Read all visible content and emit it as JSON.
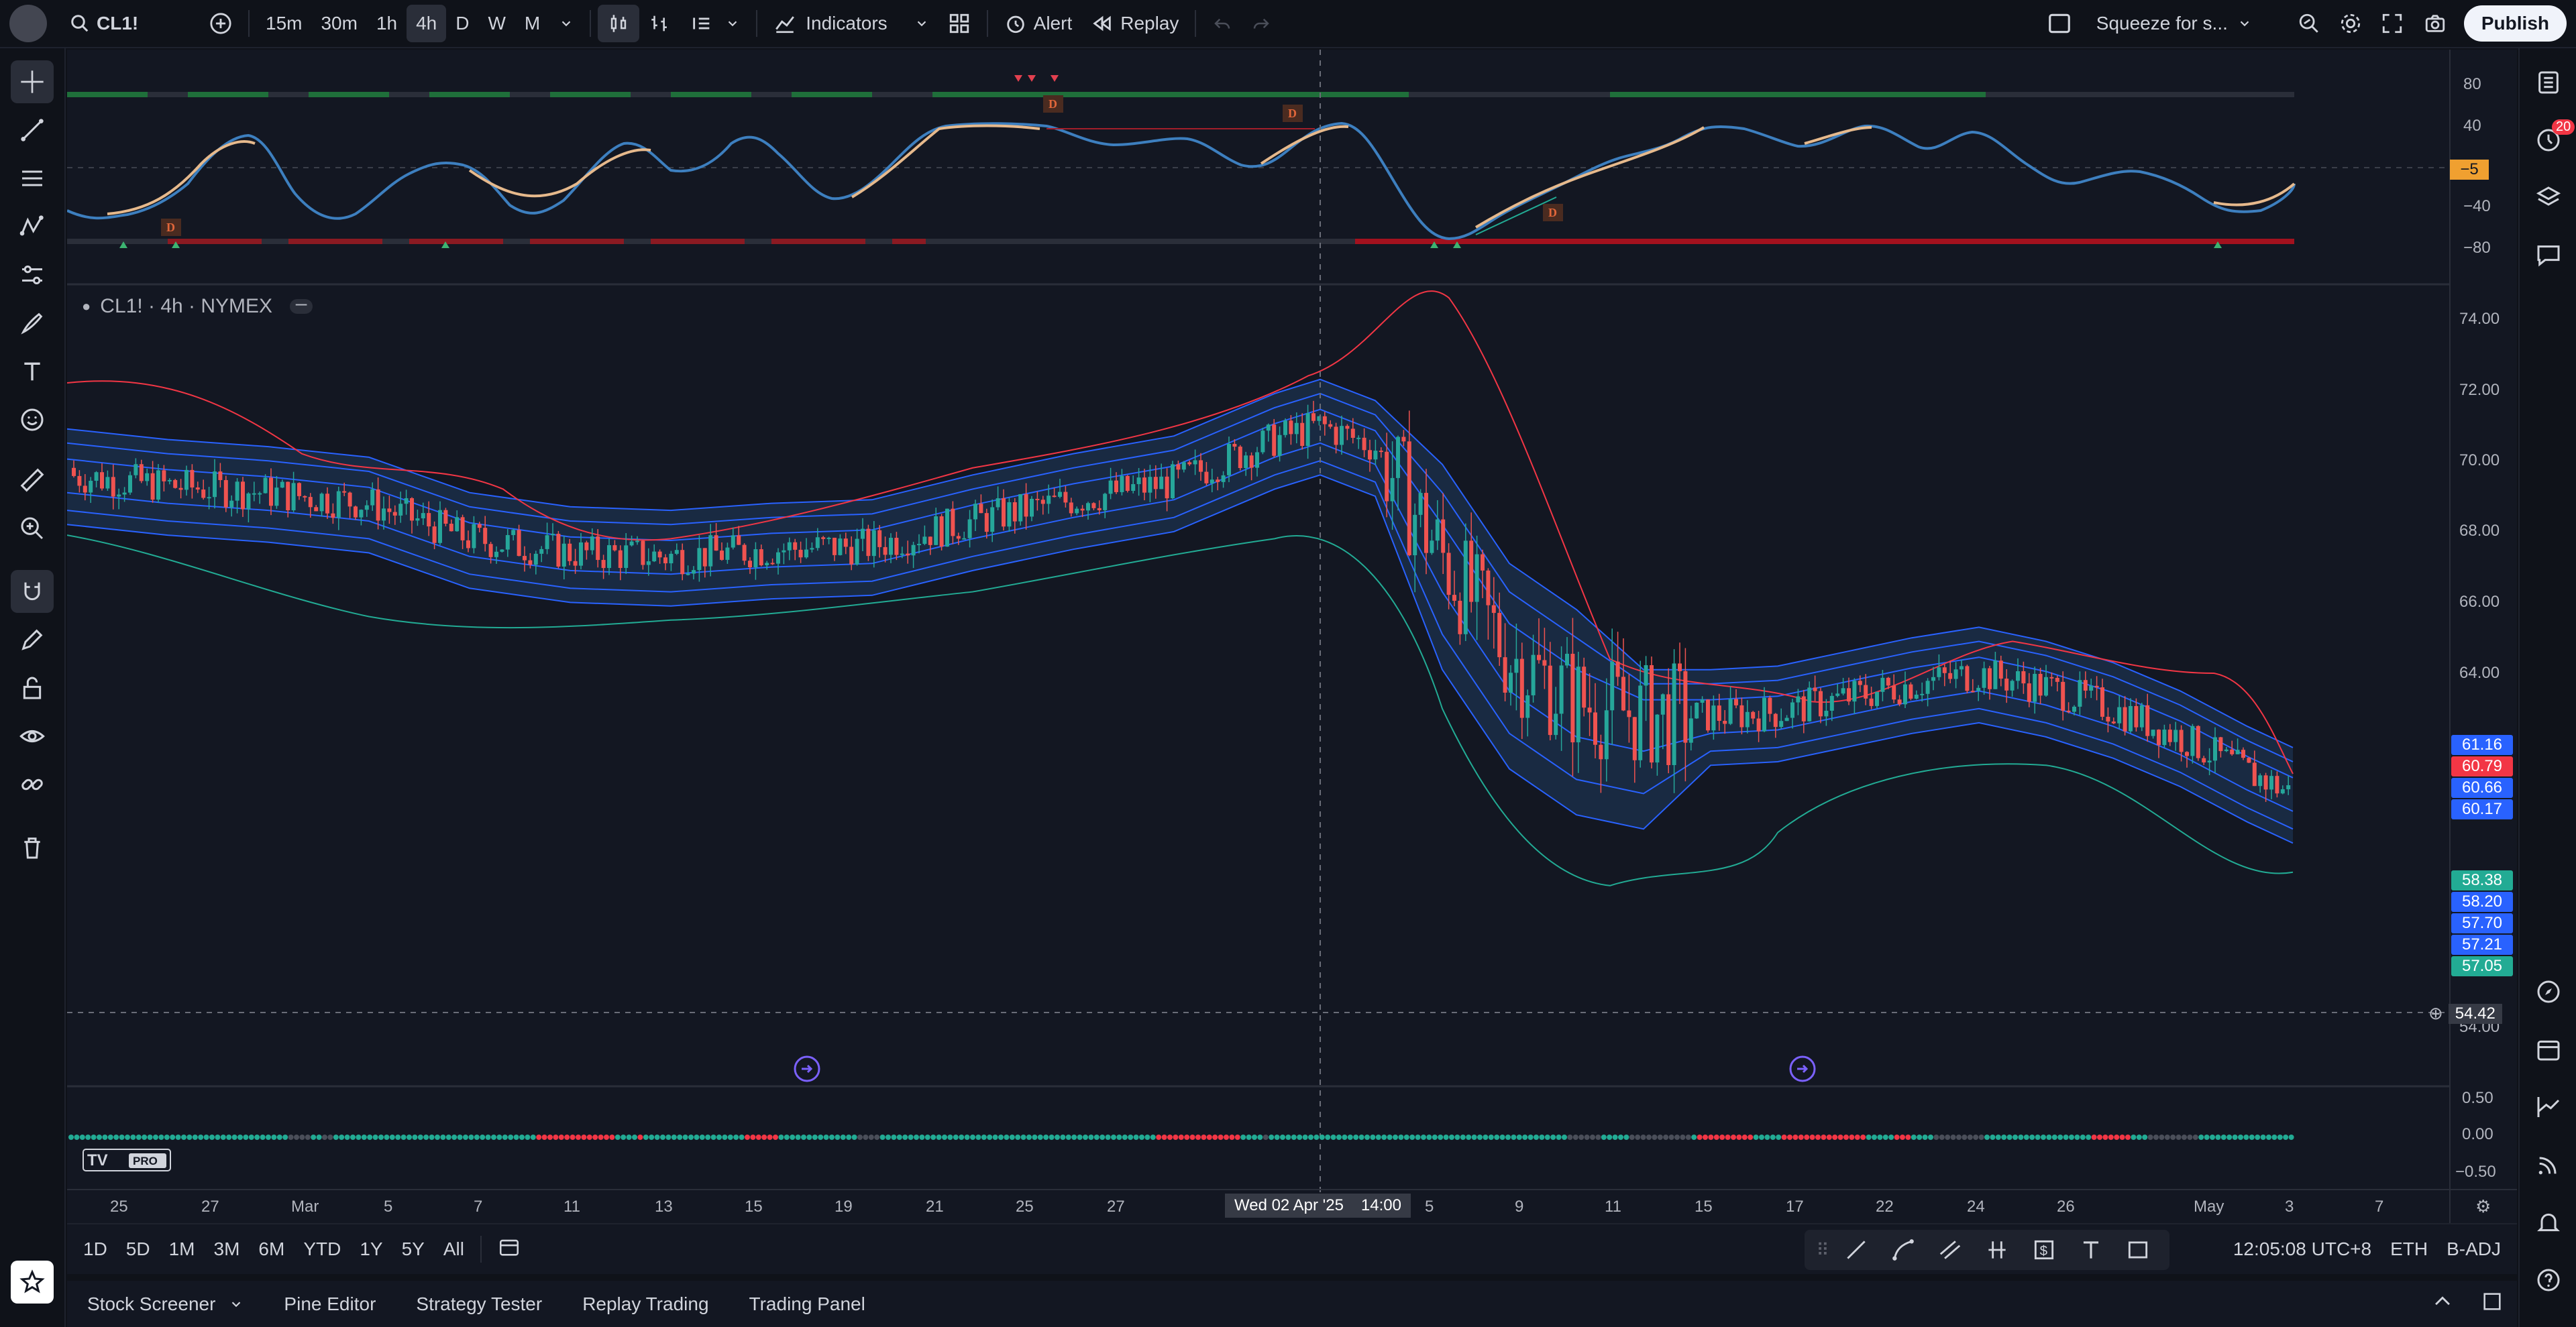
{
  "topbar": {
    "symbol": "CL1!",
    "intervals": [
      "15m",
      "30m",
      "1h",
      "4h",
      "D",
      "W",
      "M"
    ],
    "active_interval": "4h",
    "indicators_label": "Indicators",
    "alert_label": "Alert",
    "replay_label": "Replay",
    "layout_name": "Squeeze for s...",
    "publish_label": "Publish"
  },
  "legend": {
    "symbol_line": "CL1! · 4h · NYMEX"
  },
  "oscillator_axis": [
    "80",
    "40",
    "−40",
    "−80"
  ],
  "oscillator_current": "−5",
  "price_axis": [
    "74.00",
    "72.00",
    "70.00",
    "68.00",
    "66.00",
    "64.00",
    "54.00"
  ],
  "price_labels": [
    {
      "text": "61.16",
      "color": "#2962ff"
    },
    {
      "text": "60.79",
      "color": "#f23645"
    },
    {
      "text": "60.66",
      "color": "#2962ff"
    },
    {
      "text": "60.17",
      "color": "#2962ff"
    },
    {
      "text": "58.38",
      "color": "#22ab94"
    },
    {
      "text": "58.20",
      "color": "#2962ff"
    },
    {
      "text": "57.70",
      "color": "#2962ff"
    },
    {
      "text": "57.21",
      "color": "#2962ff"
    },
    {
      "text": "57.05",
      "color": "#22ab94"
    }
  ],
  "crosshair_price": "54.42",
  "squeeze_axis": [
    "0.50",
    "0.00",
    "−0.50"
  ],
  "time_axis": [
    "25",
    "27",
    "Mar",
    "5",
    "7",
    "11",
    "13",
    "15",
    "19",
    "21",
    "25",
    "27",
    "5",
    "9",
    "11",
    "15",
    "17",
    "22",
    "24",
    "26",
    "May",
    "3",
    "7"
  ],
  "crosshair_time": "Wed 02 Apr '25",
  "crosshair_time2": "14:00",
  "tv_logo_badge": "PRO",
  "divergence_label": "D",
  "rangebar": {
    "ranges": [
      "1D",
      "5D",
      "1M",
      "3M",
      "6M",
      "YTD",
      "1Y",
      "5Y",
      "All"
    ],
    "clock": "12:05:08 UTC+8",
    "session": "ETH",
    "adjust": "B-ADJ"
  },
  "bottompanel": {
    "tabs": [
      "Stock Screener",
      "Pine Editor",
      "Strategy Tester",
      "Replay Trading",
      "Trading Panel"
    ]
  },
  "right_badge": "20",
  "colors": {
    "up": "#26a69a",
    "down": "#ef5350",
    "band": "#2962ff",
    "upper": "#f23645",
    "lower": "#22ab94"
  }
}
